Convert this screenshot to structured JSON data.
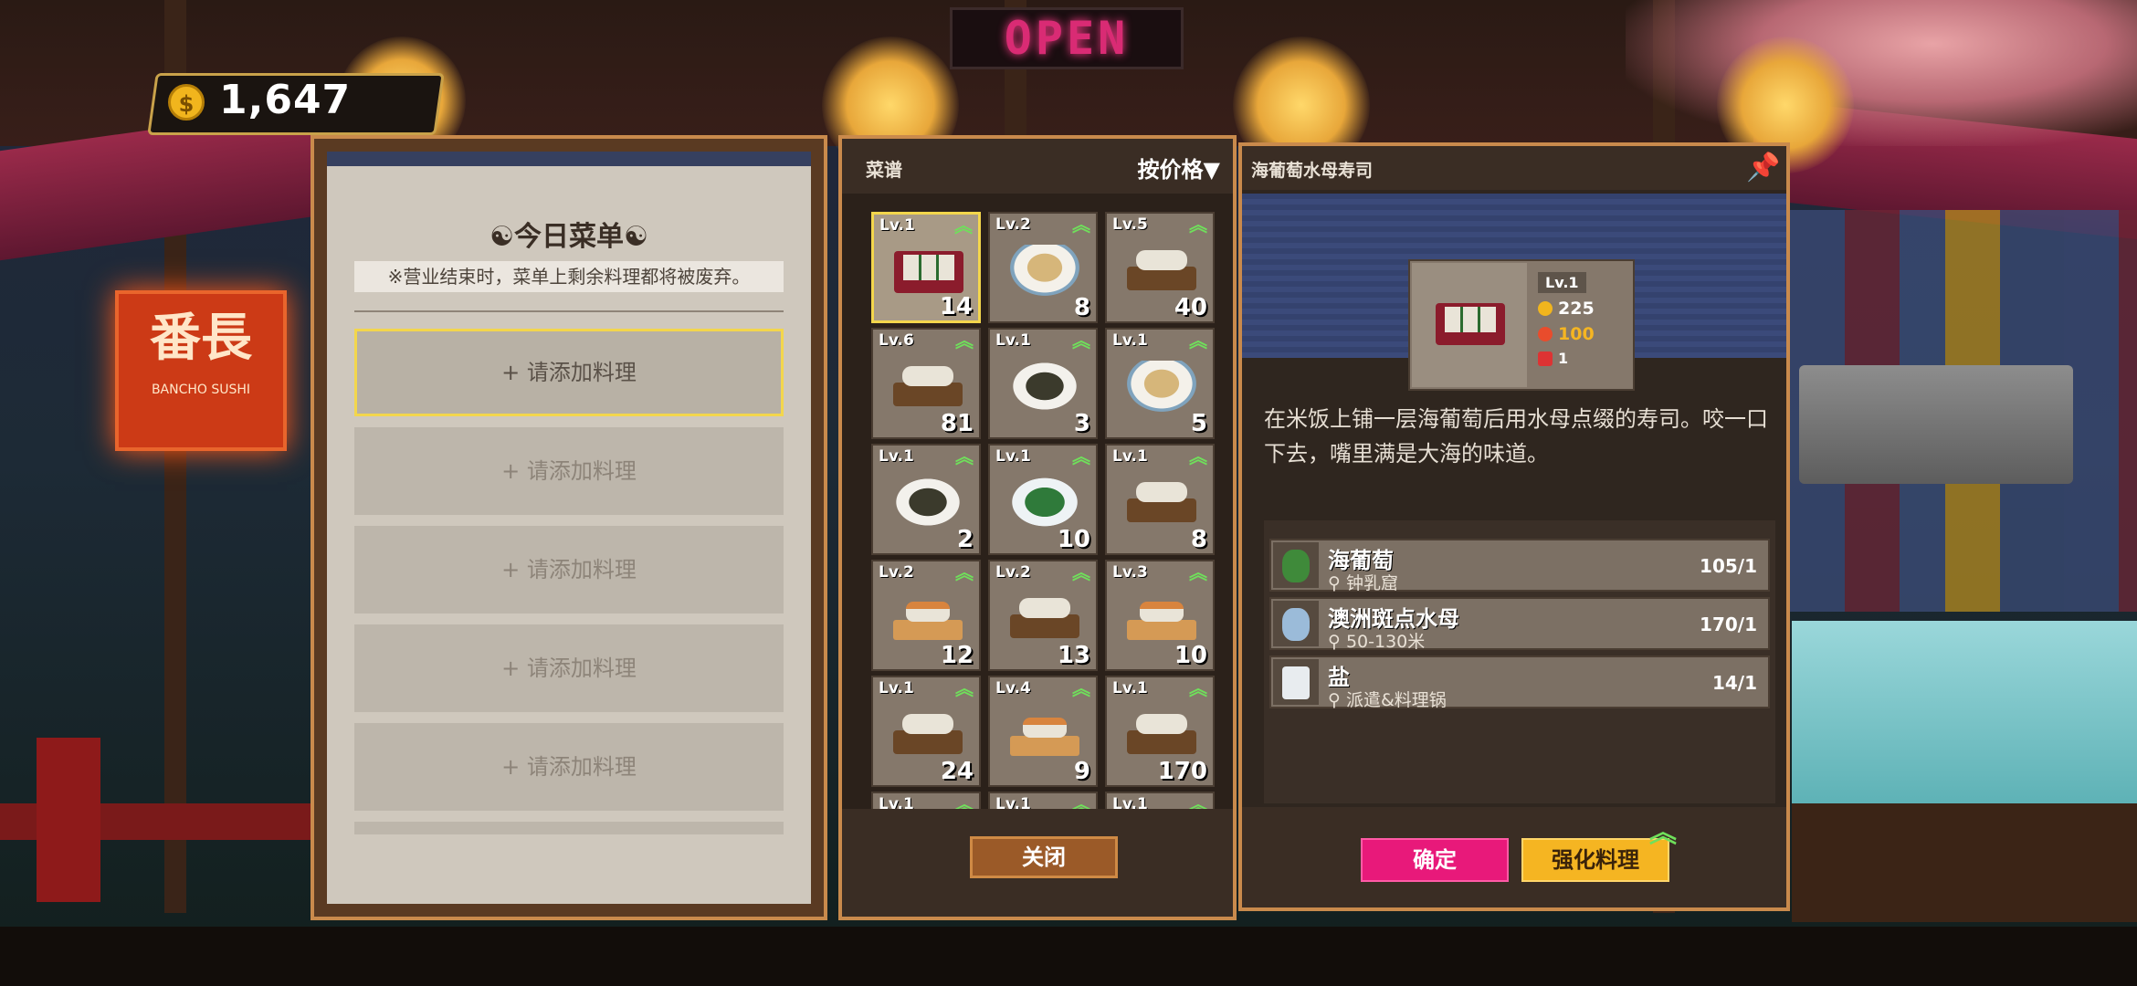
{
  "hud": {
    "coins": "1,647",
    "coin_symbol": "$"
  },
  "scene": {
    "open_sign": "OPEN",
    "bancho_sign_big": "番長",
    "bancho_sign_small": "BANCHO SUSHI"
  },
  "menu": {
    "title": "☯今日菜单☯",
    "note": "※营业结束时，菜单上剩余料理都将被废弃。",
    "slots": [
      "+ 请添加料理",
      "+ 请添加料理",
      "+ 请添加料理",
      "+ 请添加料理",
      "+ 请添加料理"
    ]
  },
  "recipes": {
    "label": "菜谱",
    "sort": "按价格▼",
    "close": "关闭",
    "items": [
      {
        "lv": "Lv.1",
        "count": "14",
        "style": "tray"
      },
      {
        "lv": "Lv.2",
        "count": "8",
        "style": "bowl"
      },
      {
        "lv": "Lv.5",
        "count": "40",
        "style": "board"
      },
      {
        "lv": "Lv.6",
        "count": "81",
        "style": "board"
      },
      {
        "lv": "Lv.1",
        "count": "3",
        "style": "plate"
      },
      {
        "lv": "Lv.1",
        "count": "5",
        "style": "bowl"
      },
      {
        "lv": "Lv.1",
        "count": "2",
        "style": "plate"
      },
      {
        "lv": "Lv.1",
        "count": "10",
        "style": "greens"
      },
      {
        "lv": "Lv.1",
        "count": "8",
        "style": "board"
      },
      {
        "lv": "Lv.2",
        "count": "12",
        "style": "wood"
      },
      {
        "lv": "Lv.2",
        "count": "13",
        "style": "board"
      },
      {
        "lv": "Lv.3",
        "count": "10",
        "style": "wood"
      },
      {
        "lv": "Lv.1",
        "count": "24",
        "style": "board"
      },
      {
        "lv": "Lv.4",
        "count": "9",
        "style": "wood"
      },
      {
        "lv": "Lv.1",
        "count": "170",
        "style": "board"
      },
      {
        "lv": "Lv.1",
        "count": "",
        "style": "board"
      },
      {
        "lv": "Lv.1",
        "count": "",
        "style": "board"
      },
      {
        "lv": "Lv.1",
        "count": "",
        "style": "board"
      }
    ],
    "upgrade_arrow": "︽"
  },
  "detail": {
    "title": "海葡萄水母寿司",
    "level": "Lv.1",
    "price": "225",
    "popularity": "100",
    "servings": "1",
    "description": "在米饭上铺一层海葡萄后用水母点缀的寿司。咬一口下去，嘴里满是大海的味道。",
    "ingredients": [
      {
        "name": "海葡萄",
        "location": "钟乳窟",
        "count": "105/1",
        "color": "#3f8a3a"
      },
      {
        "name": "澳洲斑点水母",
        "location": "50-130米",
        "count": "170/1",
        "color": "#9bbbd9"
      },
      {
        "name": "盐",
        "location": "派遣&料理锅",
        "count": "14/1",
        "color": "#e8ecef"
      }
    ],
    "confirm": "确定",
    "enhance": "强化料理"
  },
  "colors": {
    "accent_pink": "#e8197a",
    "accent_gold": "#f5b522",
    "upgrade_green": "#6fe05b"
  }
}
